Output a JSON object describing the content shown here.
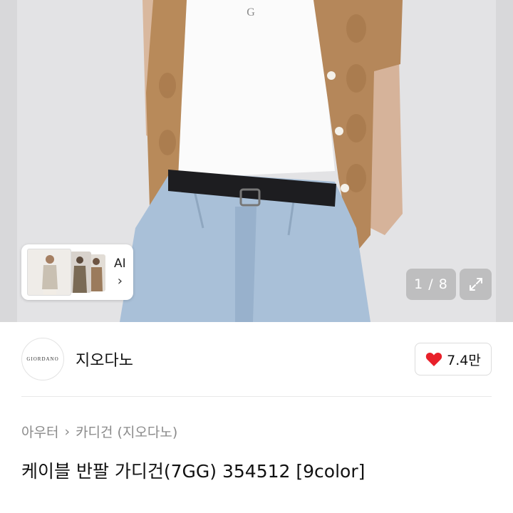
{
  "gallery": {
    "ai_label": "AI",
    "ai_chevron": "›",
    "counter_text": "1 / 8",
    "expand_icon": "expand-icon"
  },
  "brand": {
    "logo_text": "GIORDANO",
    "name": "지오다노",
    "like_icon": "heart-icon",
    "like_color": "#e8202a",
    "like_count": "7.4만"
  },
  "breadcrumb": {
    "items": [
      "아우터",
      "카디건 (지오다노)"
    ],
    "separator": "›"
  },
  "product": {
    "title": "케이블 반팔 가디건(7GG) 354512 [9color]"
  }
}
